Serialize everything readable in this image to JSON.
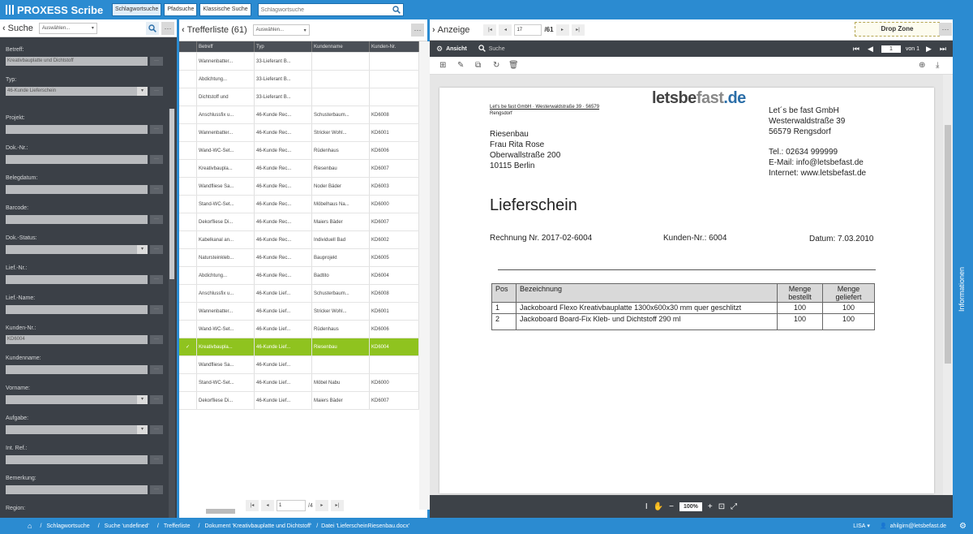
{
  "app": {
    "title": "PROXESS Scribe"
  },
  "topbar": {
    "tabs": [
      {
        "label": "Schlagwortsuche"
      },
      {
        "label": "Pfadsuche"
      },
      {
        "label": "Klassische Suche"
      }
    ],
    "search_placeholder": "Schlagwortsuche"
  },
  "left": {
    "title": "Suche",
    "dropdown": "Auswählen...",
    "fields": [
      {
        "label": "Betreff:",
        "value": "Kreativbauplatte und Dichtstoff",
        "kind": "text"
      },
      {
        "label": "Typ:",
        "value": "46-Kunde Lieferschein",
        "kind": "select"
      },
      {
        "label": "Projekt:",
        "value": "",
        "kind": "text"
      },
      {
        "label": "Dok.-Nr.:",
        "value": "",
        "kind": "text"
      },
      {
        "label": "Belegdatum:",
        "value": "",
        "kind": "text"
      },
      {
        "label": "Barcode:",
        "value": "",
        "kind": "text"
      },
      {
        "label": "Dok.-Status:",
        "value": "",
        "kind": "select"
      },
      {
        "label": "Lief.-Nr.:",
        "value": "",
        "kind": "text"
      },
      {
        "label": "Lief.-Name:",
        "value": "",
        "kind": "text"
      },
      {
        "label": "Kunden-Nr.:",
        "value": "KD6004",
        "kind": "text"
      },
      {
        "label": "Kundenname:",
        "value": "",
        "kind": "text"
      },
      {
        "label": "Vorname:",
        "value": "",
        "kind": "select"
      },
      {
        "label": "Aufgabe:",
        "value": "",
        "kind": "select"
      },
      {
        "label": "Int. Ref.:",
        "value": "",
        "kind": "text"
      },
      {
        "label": "Bemerkung:",
        "value": "",
        "kind": "text"
      },
      {
        "label": "Region:",
        "value": "",
        "kind": "none"
      }
    ]
  },
  "middle": {
    "title": "Trefferliste (61)",
    "dropdown": "Auswählen...",
    "columns": [
      "Betreff",
      "Typ",
      "Kundenname",
      "Kunden-Nr."
    ],
    "rows": [
      [
        "Wannenbatter...",
        "33-Lieferant B...",
        "",
        ""
      ],
      [
        "Abdichtung...",
        "33-Lieferant B...",
        "",
        ""
      ],
      [
        "Dichtstoff und",
        "33-Lieferant B...",
        "",
        ""
      ],
      [
        "Anschlussfix u...",
        "46-Kunde Rec...",
        "Schusterbaum...",
        "KD6008"
      ],
      [
        "Wannenbatter...",
        "46-Kunde Rec...",
        "Stricker Wohl...",
        "KD6001"
      ],
      [
        "Wand-WC-Set...",
        "46-Kunde Rec...",
        "Rüdenhaus",
        "KD6006"
      ],
      [
        "Kreativbaupla...",
        "46-Kunde Rec...",
        "Riesenbau",
        "KD6007"
      ],
      [
        "Wandfliese Sa...",
        "46-Kunde Rec...",
        "Noder Bäder",
        "KD6003"
      ],
      [
        "Stand-WC-Set...",
        "46-Kunde Rec...",
        "Möbelhaus Na...",
        "KD6000"
      ],
      [
        "Dekorfliese Di...",
        "46-Kunde Rec...",
        "Maiers Bäder",
        "KD6007"
      ],
      [
        "Kabelkanal an...",
        "46-Kunde Rec...",
        "Individuell Bad",
        "KD6002"
      ],
      [
        "Natursteinkleb...",
        "46-Kunde Rec...",
        "Bauprojekt",
        "KD6005"
      ],
      [
        "Abdichtung...",
        "46-Kunde Rec...",
        "Badtito",
        "KD6004"
      ],
      [
        "Anschlussfix u...",
        "46-Kunde Lief...",
        "Schusterbaum...",
        "KD6008"
      ],
      [
        "Wannenbatter...",
        "46-Kunde Lief...",
        "Stricker Wohl...",
        "KD6001"
      ],
      [
        "Wand-WC-Set...",
        "46-Kunde Lief...",
        "Rüdenhaus",
        "KD6006"
      ],
      [
        "Kreativbaupla...",
        "46-Kunde Lief...",
        "Riesenbau",
        "KD6004"
      ],
      [
        "Wandfliese Sa...",
        "46-Kunde Lief...",
        "",
        ""
      ],
      [
        "Stand-WC-Set...",
        "46-Kunde Lief...",
        "Möbel Nabu",
        "KD6000"
      ],
      [
        "Dekorfliese Di...",
        "46-Kunde Lief...",
        "Maiers Bäder",
        "KD6007"
      ]
    ],
    "selected_row": 16,
    "pager_value": "1",
    "pager_of": "/4"
  },
  "right": {
    "title": "Anzeige",
    "nav_value": "17",
    "nav_total": "/61",
    "drop_zone": "Drop Zone",
    "view_label": "Ansicht",
    "search_label": "Suche",
    "page_value": "1",
    "page_of": "von 1",
    "zoom": "100%"
  },
  "document": {
    "logo_left": "letsbe",
    "logo_mid": "fast",
    "logo_right": ".de",
    "sender_line": "Let's be fast GmbH · Westerwaldstraße 39 · 56579",
    "sender_line2": "Rengsdorf",
    "recipient": [
      "Riesenbau",
      "Frau Rita Rose",
      "Oberwallstraße 200",
      "10115 Berlin"
    ],
    "company": [
      "Let´s be fast GmbH",
      "Westerwaldstraße 39",
      "56579 Rengsdorf"
    ],
    "contact": [
      "Tel.: 02634 999999",
      "E-Mail: info@letsbefast.de",
      "Internet: www.letsbefast.de"
    ],
    "heading": "Lieferschein",
    "invoice": "Rechnung Nr. 2017-02-6004",
    "customer_no": "Kunden-Nr.: 6004",
    "date": "Datum: 7.03.2010",
    "table_headers": [
      "Pos",
      "Bezeichnung",
      "Menge bestellt",
      "Menge geliefert"
    ],
    "table_rows": [
      [
        "1",
        "Jackoboard Flexo Kreativbauplatte 1300x600x30 mm quer geschlitzt",
        "100",
        "100"
      ],
      [
        "2",
        "Jackoboard Board-Fix Kleb- und Dichtstoff 290 ml",
        "100",
        "100"
      ]
    ]
  },
  "strip": {
    "label": "Informationen"
  },
  "status": {
    "breadcrumbs": [
      "Schlagwortsuche",
      "Suche 'undefined'",
      "Trefferliste",
      "Dokument 'Kreativbauplatte und Dichtstoff'",
      "Datei 'LieferscheinRiesenbau.docx'"
    ],
    "lang": "LISA",
    "user": "ahilgirn@letsbefast.de"
  },
  "colors": {
    "accent": "#2b8bd1",
    "selected": "#8fc31f",
    "dark": "#3b4047"
  }
}
